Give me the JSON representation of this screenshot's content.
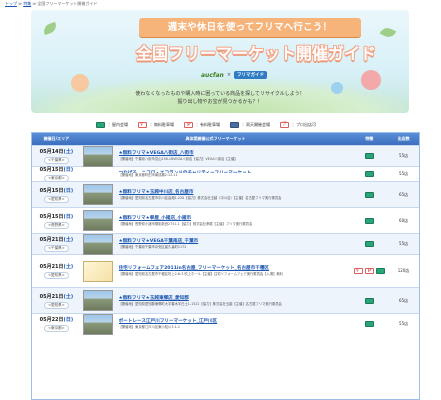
{
  "breadcrumb": {
    "home": "トップ",
    "sep": "≫",
    "parent": "特集",
    "current": "全国フリーマーケット開催ガイド"
  },
  "banner": {
    "ribbon": "週末や休日を使ってフリマへ行こう！",
    "title": "全国フリーマーケット開催ガイド",
    "logo_left": "aucfan",
    "logo_x": "×",
    "logo_right": "フリマガイド",
    "lead_line1": "使わなくなったものや購入時に困っている商品を探してリサイクルしよう！",
    "lead_line2": "掘り出し物やお宝が見つかるかも？！"
  },
  "legend": [
    {
      "icon": "indoor-venue-icon",
      "label": "：屋内会場"
    },
    {
      "icon": "free-entry-icon",
      "label": "：無料駐車場"
    },
    {
      "icon": "free-parking-icon",
      "label": "：有料駐車場"
    },
    {
      "icon": "rain-ok-icon",
      "label": "：雨天開催会場"
    },
    {
      "icon": "pro-vendor-icon",
      "label": "：プロ出店可"
    }
  ],
  "table": {
    "headers": {
      "date": "開催日/エリア",
      "event": "具体案開催公式フリーマーケット",
      "features": "特徴",
      "count": "出店数"
    },
    "rows": [
      {
        "date": "05月14日",
        "dow": "(土)",
        "pref": "<千葉県>",
        "title": "★無料フリマ★VEGA八街店_八街市",
        "desc": "【開催地】千葉県八街市富山238-18VEGA八街店【協力】VEGA八街店【主催】",
        "features": [
          "indoor"
        ],
        "count": "55店",
        "thumb": "photo"
      },
      {
        "date": "05月15日",
        "dow": "(日)",
        "pref": "<東京都>",
        "title": "つなげる、ニコロ・エコランドのチャリティーフリーマーケット",
        "desc": "【開催地】東京都町田市南成瀬2-12-11",
        "features": [
          "indoor"
        ],
        "count": "55店",
        "thumb": "blank"
      },
      {
        "date": "05月15日",
        "dow": "(日)",
        "pref": "<愛知県>",
        "title": "★無料フリマ★玉越中川店_名古屋市",
        "desc": "【開催地】愛知県名古屋市中川区高畑1-220【協力】株式会社玉越（中川店）【主催】名古屋フリマ実行委員会",
        "features": [
          "indoor"
        ],
        "count": "65店",
        "thumb": "photo"
      },
      {
        "date": "05月15日",
        "dow": "(日)",
        "pref": "<長野県>",
        "title": "★無料フリマ★拳屋_小諸店_小諸市",
        "desc": "【開催地】長野県小諸市御影新田2751-1【協力】株式会社拳屋【主催】フリマ実行委員会",
        "features": [
          "indoor"
        ],
        "count": "60店",
        "thumb": "photo"
      },
      {
        "date": "05月21日",
        "dow": "(土)",
        "pref": "<千葉県>",
        "title": "★無料フリマ★VEGA千葉南店_千葉市",
        "desc": "【開催地】千葉県千葉市中央区星久喜町1172",
        "features": [
          "indoor"
        ],
        "count": "55店",
        "thumb": "photo"
      },
      {
        "date": "05月21日",
        "dow": "(土)",
        "pref": "<愛知県>",
        "title": "住宅リフォームフェア2011in名古屋_フリーマーケット_名古屋市千種区",
        "desc": "【開催地】愛知県名古屋市千種区吹上2-6-3 吹上ホール【主催】住宅リフォームフェア実行委員会【入場】無料",
        "features": [
          "free",
          "parking",
          "indoor"
        ],
        "count": "120店",
        "thumb": "poster"
      },
      {
        "date": "05月21日",
        "dow": "(土)",
        "pref": "<愛知県>",
        "title": "★無料フリマ★玉越東郷店_愛知郡",
        "desc": "【開催地】愛知県愛知郡東郷町大字春木字白土1-1522【協力】株式会社玉越【主催】名古屋フリマ実行委員会",
        "features": [
          "indoor"
        ],
        "count": "65店",
        "thumb": "photo"
      },
      {
        "date": "05月22日",
        "dow": "(日)",
        "pref": "<東京都>",
        "title": "ボートレース江戸川フリーマーケット_江戸川区",
        "desc": "【開催地】東京都江戸川区東小松川3-1-1",
        "features": [
          "indoor"
        ],
        "count": "55店",
        "thumb": "photo"
      }
    ]
  },
  "colors": {
    "accent": "#3b6fc0",
    "link": "#1a55b0",
    "ribbon": "#f6b37a"
  }
}
